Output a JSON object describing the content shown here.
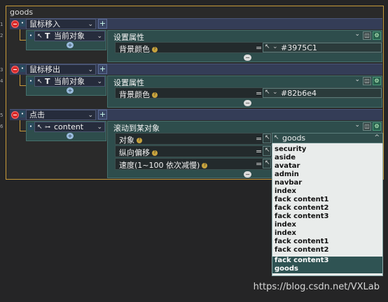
{
  "frame": {
    "title": "goods"
  },
  "line_numbers": [
    "1",
    "2",
    "3",
    "4",
    "5",
    "6"
  ],
  "blocks": [
    {
      "event": "鼠标移入",
      "target_prefix": "T",
      "target": "当前对象",
      "action": "设置属性",
      "param_label": "背景颜色",
      "value": "#3975C1"
    },
    {
      "event": "鼠标移出",
      "target_prefix": "T",
      "target": "当前对象",
      "action": "设置属性",
      "param_label": "背景颜色",
      "value": "#82b6e4"
    },
    {
      "event": "点击",
      "target_prefix": "⊶",
      "target": "content",
      "action": "滚动到某对象",
      "params": [
        {
          "label": "对象",
          "value": "goods"
        },
        {
          "label": "纵向偏移",
          "value": ""
        },
        {
          "label": "速度(1~100 依次减慢)",
          "value": ""
        }
      ]
    }
  ],
  "dropdown": {
    "selected": "goods",
    "options": [
      "security",
      "aside",
      "avatar",
      "admin",
      "navbar",
      "index",
      "fack content1",
      "fack content2",
      "fack content3",
      "index",
      "index",
      "fack content1",
      "fack content2",
      "fack content3",
      "goods"
    ]
  },
  "symbols": {
    "eq": "=",
    "plus": "+",
    "minus": "−",
    "chev": "⌄",
    "chev_up": "^",
    "q": "?",
    "cursor": "↖"
  },
  "watermark": "https://blog.csdn.net/VXLab",
  "colors": {
    "frame_border": "#c79a3a",
    "event_bar": "#343d57",
    "teal": "#2e4d4c",
    "delete": "#d92b2b"
  }
}
